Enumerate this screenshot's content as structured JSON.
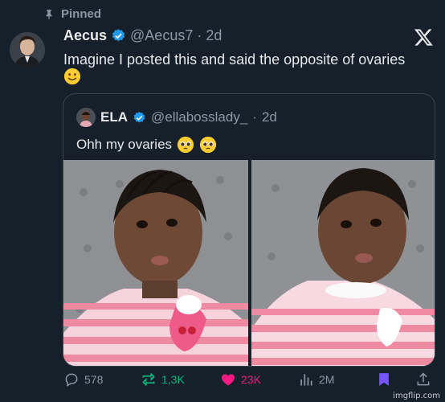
{
  "pinned_label": "Pinned",
  "tweet": {
    "author_name": "Aecus",
    "author_handle": "@Aecus7",
    "separator": "·",
    "age": "2d",
    "text": "Imagine I posted this and said the opposite of ovaries"
  },
  "quote": {
    "author_name": "ELA",
    "author_handle": "@ellabosslady_",
    "separator": "·",
    "age": "2d",
    "text": "Ohh my ovaries"
  },
  "actions": {
    "replies": "578",
    "reposts": "1,3K",
    "likes": "23K",
    "views": "2M"
  },
  "watermark": "imgflip.com",
  "colors": {
    "background": "#15202b",
    "secondary_text": "#8b98a5",
    "verified": "#1d9bf0",
    "repost_active": "#00ba7c",
    "like_active": "#f91880",
    "bookmark_active": "#7856ff",
    "border": "#38444d"
  },
  "icons": {
    "pin": "pin-icon",
    "verified": "verified-badge-icon",
    "x_logo": "x-logo-icon",
    "reply": "reply-icon",
    "repost": "repost-icon",
    "like": "heart-icon",
    "views": "views-icon",
    "bookmark": "bookmark-icon",
    "share": "share-icon"
  }
}
